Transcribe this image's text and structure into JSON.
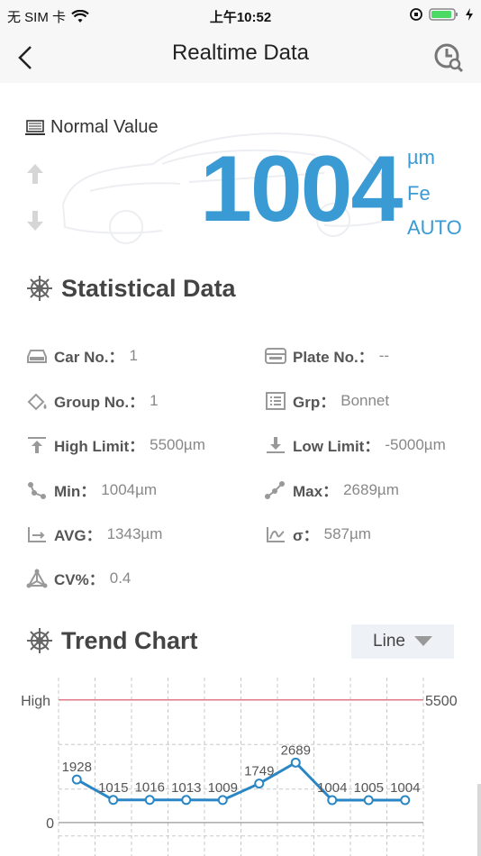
{
  "status_bar": {
    "carrier": "无 SIM 卡",
    "time": "上午10:52"
  },
  "nav": {
    "title": "Realtime Data"
  },
  "reading": {
    "label": "Normal Value",
    "value": "1004",
    "unit": "µm",
    "material": "Fe",
    "mode": "AUTO"
  },
  "statistics": {
    "title": "Statistical Data",
    "car_no": {
      "label": "Car No.：",
      "value": "1"
    },
    "plate_no": {
      "label": "Plate No.：",
      "value": "--"
    },
    "group_no": {
      "label": "Group No.：",
      "value": "1"
    },
    "grp": {
      "label": "Grp：",
      "value": "Bonnet"
    },
    "high_limit": {
      "label": "High Limit：",
      "value": "5500µm"
    },
    "low_limit": {
      "label": "Low Limit：",
      "value": "-5000µm"
    },
    "min": {
      "label": "Min：",
      "value": "1004µm"
    },
    "max": {
      "label": "Max：",
      "value": "2689µm"
    },
    "avg": {
      "label": "AVG：",
      "value": "1343µm"
    },
    "sigma": {
      "label": "σ：",
      "value": "587µm"
    },
    "cv": {
      "label": "CV%：",
      "value": "0.4"
    }
  },
  "trend": {
    "title": "Trend Chart",
    "chart_type_selected": "Line"
  },
  "chart_data": {
    "type": "line",
    "y_tick_labels": [
      "High",
      "0"
    ],
    "high_limit_label": "5500",
    "high_limit": 5500,
    "ylim": [
      -1500,
      6500
    ],
    "values": [
      1928,
      1015,
      1016,
      1013,
      1009,
      1749,
      2689,
      1004,
      1005,
      1004
    ],
    "colors": {
      "line": "#2a86c4",
      "high_line": "#e07a8a",
      "zero_line": "#999999",
      "grid": "#c8c8c8"
    },
    "grid": true
  },
  "colors": {
    "accent": "#3a9ad4",
    "nav_bg": "#f7f7f7"
  }
}
